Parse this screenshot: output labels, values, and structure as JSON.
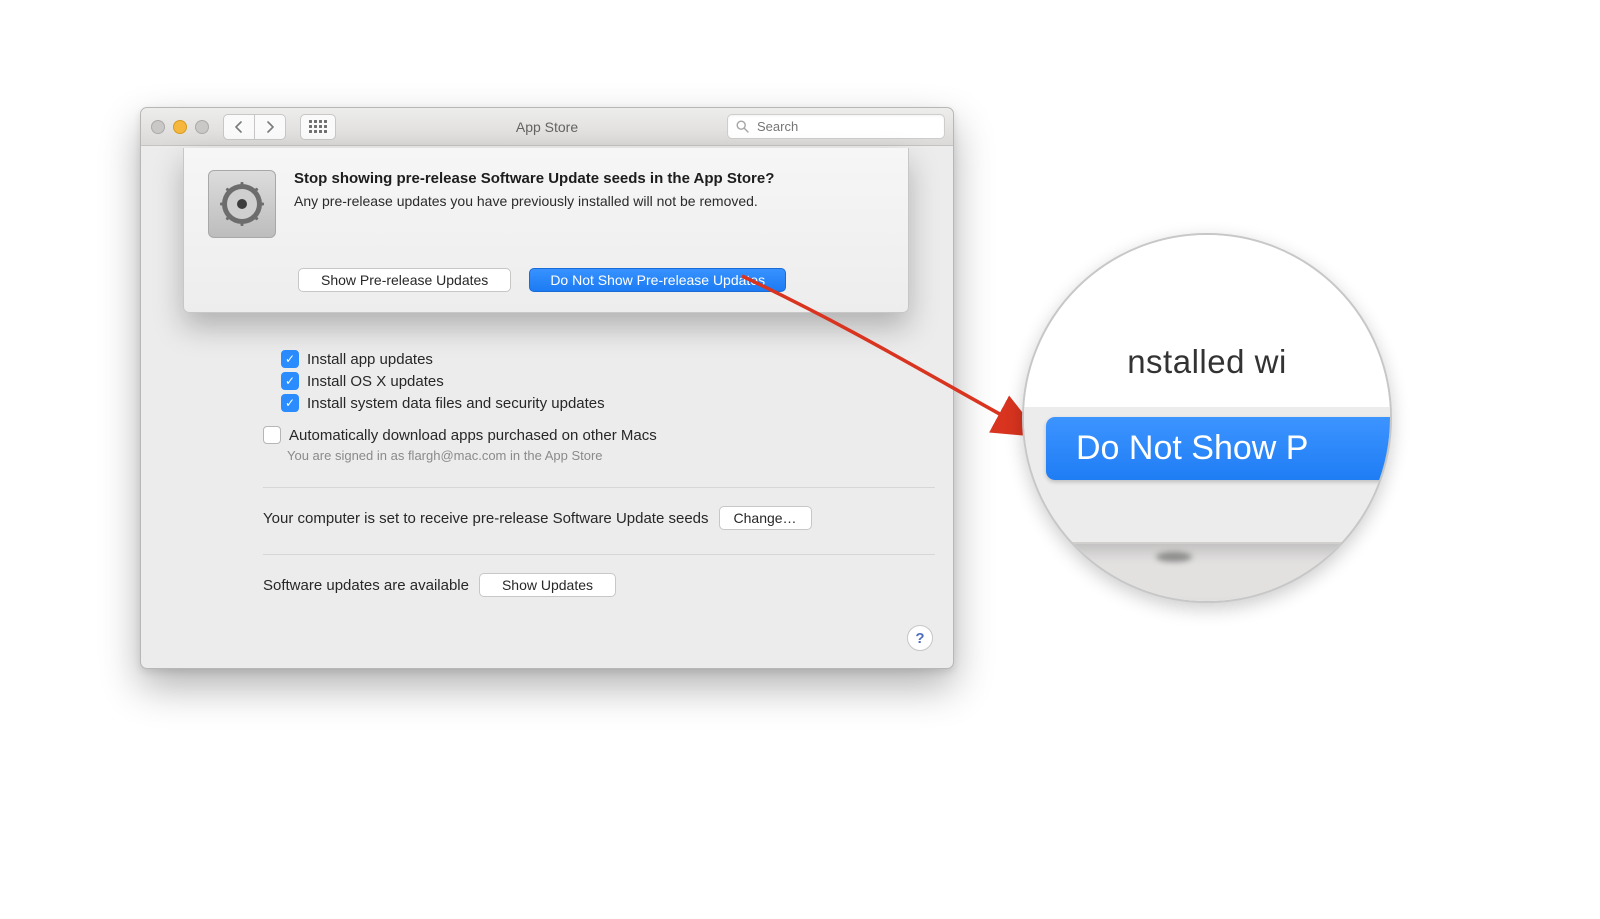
{
  "window": {
    "title": "App Store",
    "search_placeholder": "Search"
  },
  "dialog": {
    "heading": "Stop showing pre-release Software Update seeds in the App Store?",
    "body": "Any pre-release updates you have previously installed will not be removed.",
    "buttons": {
      "secondary": "Show Pre-release Updates",
      "primary": "Do Not Show Pre-release Updates"
    }
  },
  "options": {
    "install_app_updates": "Install app updates",
    "install_osx_updates": "Install OS X updates",
    "install_security": "Install system data files and security updates",
    "auto_download": "Automatically download apps purchased on other Macs",
    "signed_in_note": "You are signed in as flargh@mac.com in the App Store"
  },
  "seed_row": {
    "text": "Your computer is set to receive pre-release Software Update seeds",
    "button": "Change…"
  },
  "updates_row": {
    "text": "Software updates are available",
    "button": "Show Updates"
  },
  "loupe": {
    "top_text": "nstalled wi",
    "button_text": "Do Not Show P"
  }
}
